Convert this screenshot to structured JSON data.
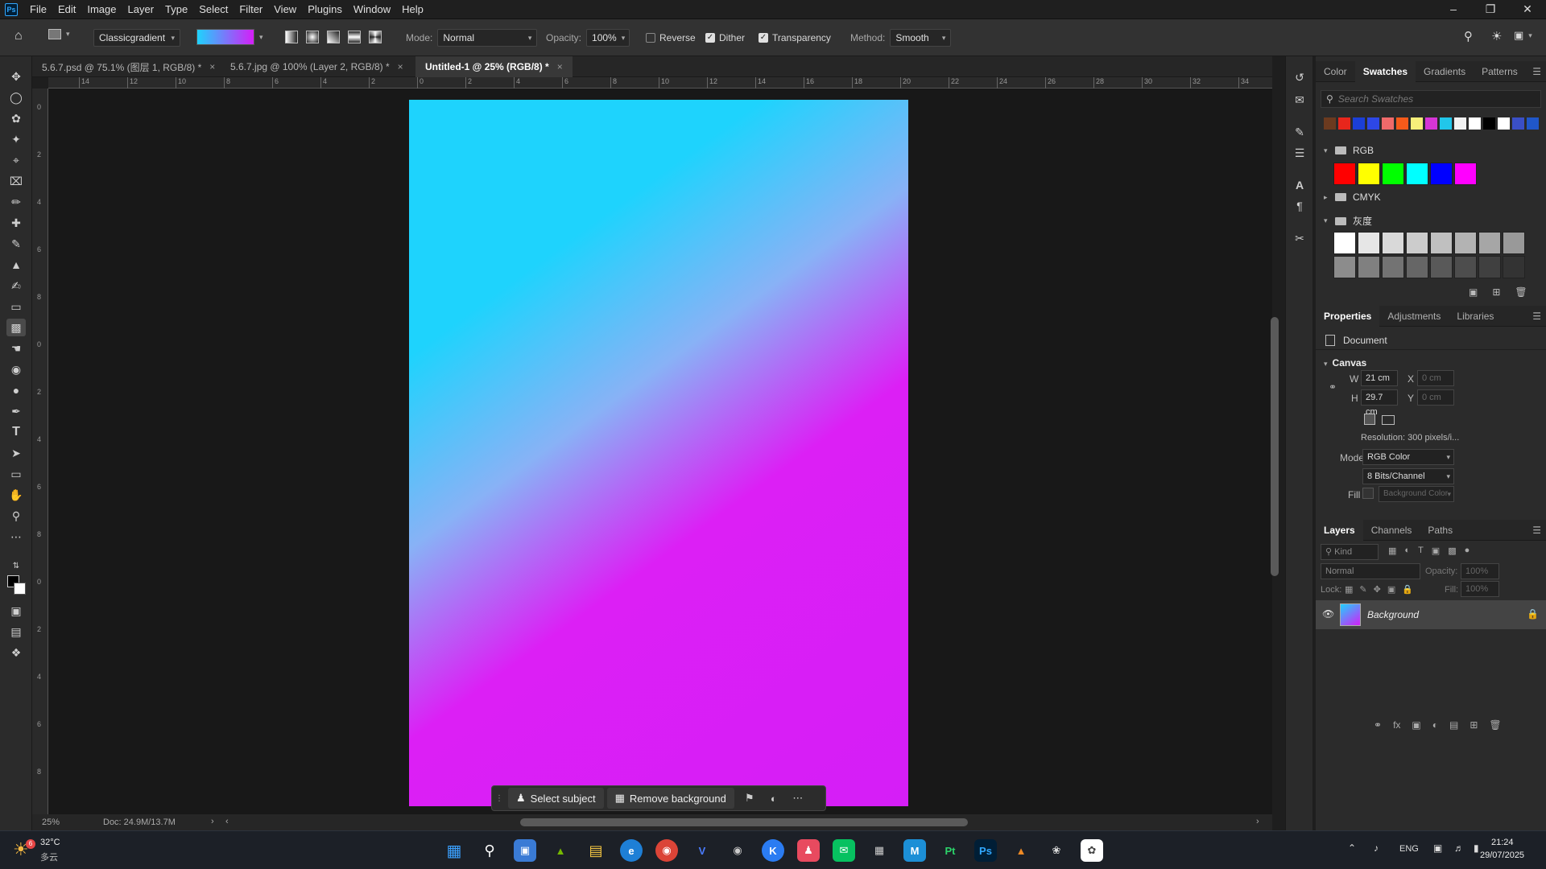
{
  "menubar": {
    "logo": "Ps",
    "items": [
      "File",
      "Edit",
      "Image",
      "Layer",
      "Type",
      "Select",
      "Filter",
      "View",
      "Plugins",
      "Window",
      "Help"
    ]
  },
  "options": {
    "gradient_type": "Classicgradient",
    "mode_label": "Mode:",
    "mode_value": "Normal",
    "opacity_label": "Opacity:",
    "opacity_value": "100%",
    "reverse_label": "Reverse",
    "dither_label": "Dither",
    "transparency_label": "Transparency",
    "method_label": "Method:",
    "method_value": "Smooth"
  },
  "tabs": [
    {
      "label": "5.6.7.psd @ 75.1% (图层 1, RGB/8) *",
      "close": "×"
    },
    {
      "label": "5.6.7.jpg @ 100% (Layer 2, RGB/8) *",
      "close": "×"
    },
    {
      "label": "Untitled-1 @ 25% (RGB/8) *",
      "close": "×"
    }
  ],
  "ruler": {
    "top": [
      "14",
      "12",
      "10",
      "8",
      "6",
      "4",
      "2",
      "0",
      "2",
      "4",
      "6",
      "8",
      "10",
      "12",
      "14",
      "16",
      "18",
      "20",
      "22",
      "24",
      "26",
      "28",
      "30",
      "32",
      "34"
    ],
    "left": [
      "0",
      "2",
      "4",
      "6",
      "8",
      "0",
      "2",
      "4",
      "6",
      "8",
      "0",
      "2",
      "4",
      "6",
      "8"
    ]
  },
  "context_bar": {
    "select_subject": "Select subject",
    "remove_background": "Remove background"
  },
  "status": {
    "zoom": "25%",
    "doc": "Doc: 24.9M/13.7M"
  },
  "swatches_panel": {
    "tabs": [
      "Color",
      "Swatches",
      "Gradients",
      "Patterns"
    ],
    "search_placeholder": "Search Swatches",
    "recent_colors": [
      "#6b3a1f",
      "#e8261c",
      "#1b3fd6",
      "#2d47e6",
      "#f06a6a",
      "#f55a1a",
      "#f7ef7a",
      "#d635d6",
      "#21c6ea",
      "#f2f2f2",
      "#ffffff",
      "#000000",
      "#ffffff",
      "#3a4fc6",
      "#2057c9"
    ],
    "groups": [
      {
        "name": "RGB",
        "colors": [
          "#ff0000",
          "#ffff00",
          "#00ff00",
          "#00ffff",
          "#0000ff",
          "#ff00ff"
        ]
      },
      {
        "name": "CMYK"
      },
      {
        "name": "灰度",
        "colors": [
          "#ffffff",
          "#e6e6e6",
          "#d9d9d9",
          "#cccccc",
          "#c0c0c0",
          "#b3b3b3",
          "#a6a6a6",
          "#999999",
          "#8c8c8c",
          "#808080",
          "#737373",
          "#666666",
          "#595959",
          "#4d4d4d",
          "#404040",
          "#333333"
        ]
      }
    ]
  },
  "properties_panel": {
    "tabs": [
      "Properties",
      "Adjustments",
      "Libraries"
    ],
    "type": "Document",
    "section": "Canvas",
    "w_label": "W",
    "w_value": "21 cm",
    "h_label": "H",
    "h_value": "29.7 cm",
    "x_label": "X",
    "x_value": "0 cm",
    "y_label": "Y",
    "y_value": "0 cm",
    "resolution": "Resolution: 300 pixels/i...",
    "mode_label": "Mode",
    "mode_value": "RGB Color",
    "bits_value": "8 Bits/Channel",
    "fill_label": "Fill",
    "fill_value": "Background Color"
  },
  "layers_panel": {
    "tabs": [
      "Layers",
      "Channels",
      "Paths"
    ],
    "kind_placeholder": "Kind",
    "blend_mode": "Normal",
    "opacity_label": "Opacity:",
    "opacity_value": "100%",
    "lock_label": "Lock:",
    "fill_label": "Fill:",
    "fill_value": "100%",
    "layers": [
      {
        "name": "Background"
      }
    ]
  },
  "taskbar": {
    "weather_temp": "32°C",
    "weather_desc": "多云",
    "weather_badge": "6",
    "lang": "ENG",
    "time": "21:24",
    "date": "29/07/2025"
  },
  "colors": {
    "gradient_start": "#1ed3fd",
    "gradient_mid": "#88b2f6",
    "gradient_end": "#d51ef7"
  }
}
